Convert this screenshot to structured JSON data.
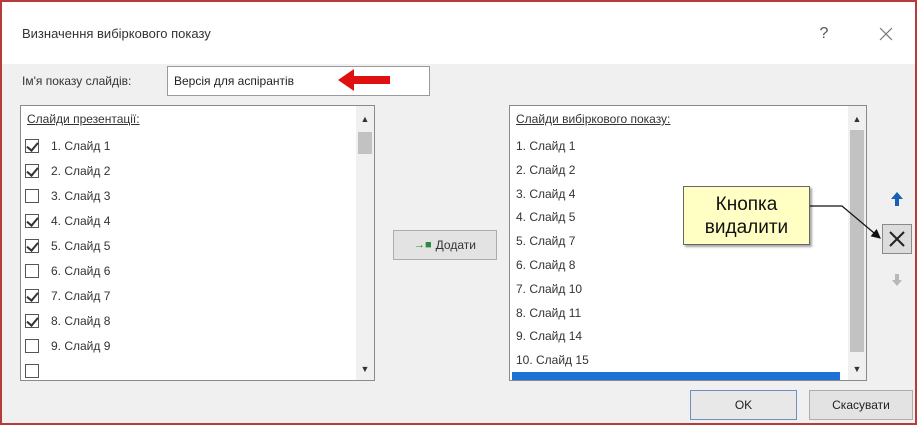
{
  "dialog": {
    "title": "Визначення вибіркового показу",
    "help_label": "?"
  },
  "show_name": {
    "label": "Ім'я показу слайдів:",
    "value": "Версія для аспірантів"
  },
  "left_list": {
    "header": "Слайди презентації:",
    "items": [
      {
        "label": "1. Слайд 1",
        "checked": true
      },
      {
        "label": "2. Слайд 2",
        "checked": true
      },
      {
        "label": "3. Слайд 3",
        "checked": false
      },
      {
        "label": "4. Слайд 4",
        "checked": true
      },
      {
        "label": "5. Слайд 5",
        "checked": true
      },
      {
        "label": "6. Слайд 6",
        "checked": false
      },
      {
        "label": "7. Слайд 7",
        "checked": true
      },
      {
        "label": "8. Слайд 8",
        "checked": true
      },
      {
        "label": "9. Слайд 9",
        "checked": false
      }
    ]
  },
  "add_button": {
    "icon": "add-arrow-icon",
    "label": "Додати"
  },
  "right_list": {
    "header": "Слайди вибіркового показу:",
    "items": [
      "1. Слайд 1",
      "2. Слайд 2",
      "3. Слайд 4",
      "4. Слайд 5",
      "5. Слайд 7",
      "6. Слайд 8",
      "7. Слайд 10",
      "8. Слайд 11",
      "9. Слайд 14",
      "10. Слайд 15"
    ]
  },
  "callout": {
    "line1": "Кнопка",
    "line2": "видалити"
  },
  "buttons": {
    "ok": "OK",
    "cancel": "Скасувати"
  },
  "colors": {
    "frame_border": "#b83b3b",
    "callout_bg": "#ffffc4",
    "selection": "#1e72d6",
    "red_arrow": "#e01010"
  }
}
